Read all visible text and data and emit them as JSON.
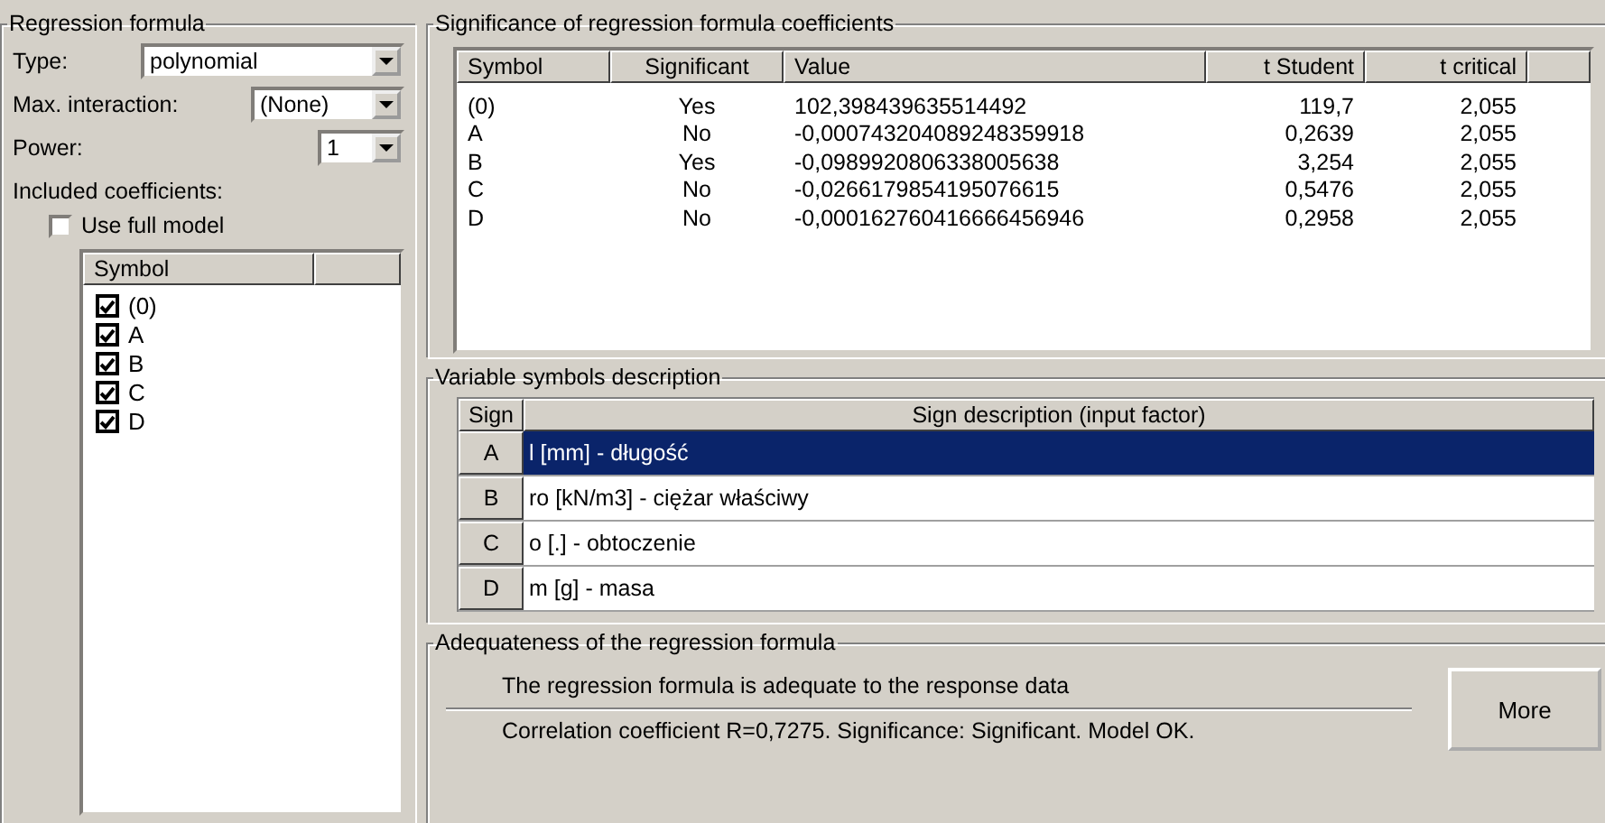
{
  "regression_formula": {
    "title": "Regression formula",
    "type": {
      "label": "Type:",
      "value": "polynomial"
    },
    "max_interaction": {
      "label": "Max. interaction:",
      "value": "(None)"
    },
    "power": {
      "label": "Power:",
      "value": "1"
    },
    "included_label": "Included coefficients:",
    "use_full_model": {
      "label": "Use full model",
      "checked": false
    },
    "coefficients": {
      "column": "Symbol",
      "items": [
        {
          "label": "(0)",
          "checked": true
        },
        {
          "label": "A",
          "checked": true
        },
        {
          "label": "B",
          "checked": true
        },
        {
          "label": "C",
          "checked": true
        },
        {
          "label": "D",
          "checked": true
        }
      ]
    }
  },
  "significance": {
    "title": "Significance of regression formula coefficients",
    "columns": [
      "Symbol",
      "Significant",
      "Value",
      "t Student",
      "t critical"
    ],
    "rows": [
      [
        "(0)",
        "Yes",
        "102,398439635514492",
        "119,7",
        "2,055"
      ],
      [
        "A",
        "No",
        "-0,000743204089248359918",
        "0,2639",
        "2,055"
      ],
      [
        "B",
        "Yes",
        "-0,0989920806338005638",
        "3,254",
        "2,055"
      ],
      [
        "C",
        "No",
        "-0,0266179854195076615",
        "0,5476",
        "2,055"
      ],
      [
        "D",
        "No",
        "-0,000162760416666456946",
        "0,2958",
        "2,055"
      ]
    ]
  },
  "variables": {
    "title": "Variable symbols description",
    "columns": [
      "Sign",
      "Sign description (input factor)"
    ],
    "rows": [
      {
        "sign": "A",
        "description": "l [mm] - długość",
        "selected": true
      },
      {
        "sign": "B",
        "description": "ro [kN/m3] - ciężar właściwy",
        "selected": false
      },
      {
        "sign": "C",
        "description": "o [.] - obtoczenie",
        "selected": false
      },
      {
        "sign": "D",
        "description": "m [g] - masa",
        "selected": false
      }
    ]
  },
  "adequateness": {
    "title": "Adequateness of the regression formula",
    "message": "The regression formula is adequate to the response data",
    "details": "Correlation coefficient R=0,7275. Significance: Significant. Model OK.",
    "button": "More"
  }
}
